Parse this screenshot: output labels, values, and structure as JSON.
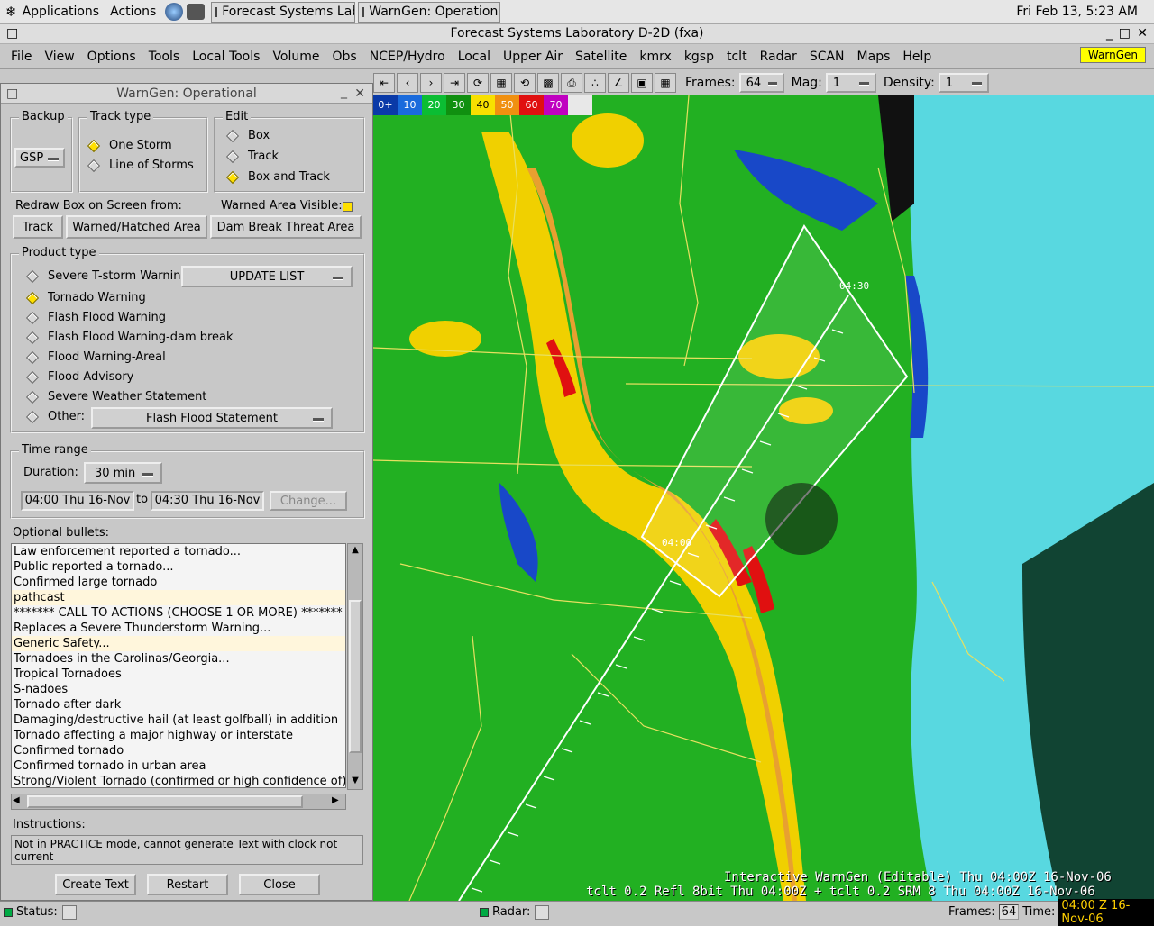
{
  "panel": {
    "applications": "Applications",
    "actions": "Actions",
    "tasks": [
      "Forecast Systems Labo",
      "WarnGen: Operational"
    ],
    "clock": "Fri Feb 13,  5:23 AM"
  },
  "main_window": {
    "title": "Forecast Systems Laboratory D-2D (fxa)",
    "menus": [
      "File",
      "View",
      "Options",
      "Tools",
      "Local Tools",
      "Volume",
      "Obs",
      "NCEP/Hydro",
      "Local",
      "Upper Air",
      "Satellite",
      "kmrx",
      "kgsp",
      "tclt",
      "Radar",
      "SCAN",
      "Maps",
      "Help"
    ],
    "warngen_button": "WarnGen"
  },
  "toolbar": {
    "frames_label": "Frames:",
    "frames_value": "64",
    "mag_label": "Mag:",
    "mag_value": "1",
    "density_label": "Density:",
    "density_value": "1"
  },
  "colorbar": {
    "labels": [
      "0+",
      "10",
      "20",
      "30",
      "40",
      "50",
      "60",
      "70",
      ""
    ],
    "colors": [
      "#0a3aa8",
      "#1a6bdc",
      "#0bbd33",
      "#109010",
      "#f8e000",
      "#f09010",
      "#e01010",
      "#c000c0",
      "#e8e8e8"
    ]
  },
  "radar": {
    "line1": "Interactive WarnGen (Editable)  Thu 04:00Z 16-Nov-06",
    "line2": "tclt 0.2 Refl  8bit Thu 04:00Z + tclt 0.2 SRM 8  Thu 04:00Z 16-Nov-06",
    "box_time_end": "04:30",
    "box_time_start": "04:00",
    "colors": {
      "green": "#22b022",
      "yellow": "#f0d000",
      "orange": "#e8a030",
      "red": "#e01010",
      "cyan": "#58d8e0",
      "blue": "#1848c8"
    }
  },
  "status_bar": {
    "status_label": "Status:",
    "radar_label": "Radar:",
    "frames_label": "Frames:",
    "frames_value": "64",
    "time_label": "Time:",
    "time_value": "04:00 Z 16-Nov-06"
  },
  "warngen": {
    "title": "WarnGen: Operational",
    "backup": {
      "label": "Backup",
      "value": "GSP"
    },
    "track_type": {
      "label": "Track type",
      "options": [
        {
          "label": "One Storm",
          "selected": true
        },
        {
          "label": "Line of Storms",
          "selected": false
        }
      ]
    },
    "edit": {
      "label": "Edit",
      "options": [
        {
          "label": "Box",
          "selected": false
        },
        {
          "label": "Track",
          "selected": false
        },
        {
          "label": "Box and Track",
          "selected": true
        }
      ]
    },
    "redraw_label": "Redraw Box on Screen from:",
    "warned_visible_label": "Warned Area Visible:",
    "redraw_buttons": [
      "Track",
      "Warned/Hatched Area",
      "Dam Break Threat Area"
    ],
    "product_type": {
      "label": "Product type",
      "update_list": "UPDATE LIST",
      "options": [
        {
          "label": "Severe T-storm Warning",
          "selected": false
        },
        {
          "label": "Tornado Warning",
          "selected": true
        },
        {
          "label": "Flash Flood Warning",
          "selected": false
        },
        {
          "label": "Flash Flood Warning-dam break",
          "selected": false
        },
        {
          "label": "Flood Warning-Areal",
          "selected": false
        },
        {
          "label": "Flood Advisory",
          "selected": false
        },
        {
          "label": "Severe Weather Statement",
          "selected": false
        },
        {
          "label": "Other:",
          "selected": false
        }
      ],
      "other_value": "Flash Flood Statement"
    },
    "time_range": {
      "label": "Time range",
      "duration_label": "Duration:",
      "duration_value": "30 min",
      "start": "04:00 Thu 16-Nov",
      "to": "to",
      "end": "04:30 Thu 16-Nov",
      "change": "Change..."
    },
    "optional_bullets_label": "Optional bullets:",
    "bullets": [
      {
        "text": "Law enforcement reported a tornado...",
        "sel": false
      },
      {
        "text": "Public reported a tornado...",
        "sel": false
      },
      {
        "text": "Confirmed large tornado",
        "sel": false
      },
      {
        "text": "pathcast",
        "sel": true
      },
      {
        "text": "******* CALL TO ACTIONS (CHOOSE 1 OR MORE) *******",
        "sel": false
      },
      {
        "text": "Replaces a Severe Thunderstorm Warning...",
        "sel": false
      },
      {
        "text": "Generic Safety...",
        "sel": true
      },
      {
        "text": "Tornadoes in the Carolinas/Georgia...",
        "sel": false
      },
      {
        "text": "Tropical Tornadoes",
        "sel": false
      },
      {
        "text": "S-nadoes",
        "sel": false
      },
      {
        "text": "Tornado after dark",
        "sel": false
      },
      {
        "text": "Damaging/destructive hail (at least golfball) in addition",
        "sel": false
      },
      {
        "text": "Tornado affecting a major highway or interstate",
        "sel": false
      },
      {
        "text": "Confirmed tornado",
        "sel": false
      },
      {
        "text": "Confirmed tornado in urban area",
        "sel": false
      },
      {
        "text": "Strong/Violent Tornado (confirmed or high confidence of)",
        "sel": false
      }
    ],
    "instructions_label": "Instructions:",
    "instructions_text": "Not in PRACTICE mode, cannot generate Text with clock not current",
    "buttons": {
      "create": "Create Text",
      "restart": "Restart",
      "close": "Close"
    }
  }
}
